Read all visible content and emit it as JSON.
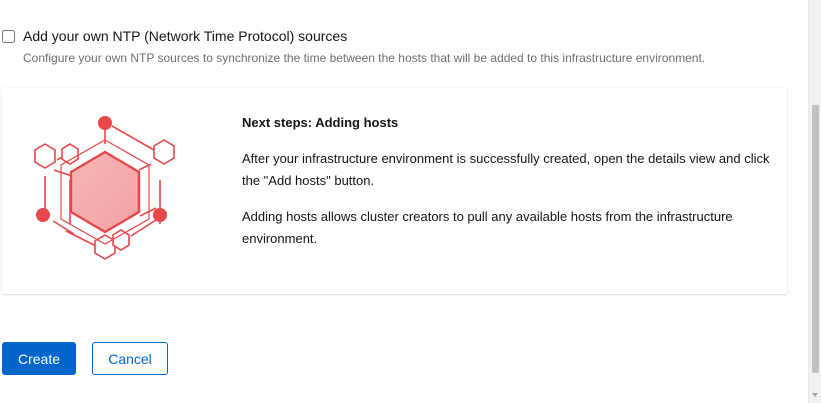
{
  "ntp": {
    "label": "Add your own NTP (Network Time Protocol) sources",
    "description": "Configure your own NTP sources to synchronize the time between the hosts that will be added to this infrastructure environment.",
    "checked": false
  },
  "next_steps": {
    "title": "Next steps: Adding hosts",
    "paragraph1": "After your infrastructure environment is successfully created, open the details view and click the \"Add hosts\" button.",
    "paragraph2": "Adding hosts allows cluster creators to pull any available hosts from the infrastructure environment.",
    "illustration_icon": "hosts-network-icon",
    "accent_color": "#e8474a"
  },
  "actions": {
    "create_label": "Create",
    "cancel_label": "Cancel",
    "primary_color": "#0066cc"
  }
}
